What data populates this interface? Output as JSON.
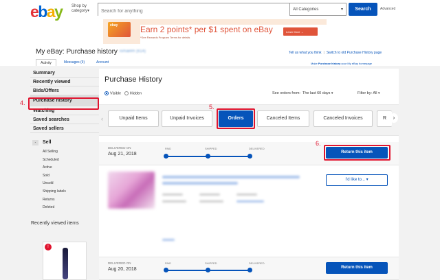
{
  "header": {
    "logo": {
      "e": "e",
      "b": "b",
      "a": "a",
      "y": "y"
    },
    "shop_by": "Shop by category",
    "search_placeholder": "Search for anything",
    "category": "All Categories",
    "search_label": "Search",
    "advanced": "Advanced"
  },
  "banner": {
    "card_label": "ebay",
    "headline": "Earn 2 points* per $1 spent on eBay",
    "fineprint": "*See Rewards Program Terms for details",
    "learn_more": "Learn More"
  },
  "page": {
    "title": "My eBay: Purchase history",
    "username": "ismaelm (614)",
    "links": [
      "Tell us what you think",
      "Switch to old Purchase History page"
    ],
    "homepage_note_pre": "Make ",
    "homepage_note_bold": "Purchase history",
    "homepage_note_post": " your My eBay homepage",
    "tabs": [
      "Activity",
      "Messages (9)",
      "Account"
    ]
  },
  "sidebar": {
    "items": [
      "Summary",
      "Recently viewed",
      "Bids/Offers",
      "Purchase history",
      "Watching",
      "Saved searches",
      "Saved sellers"
    ],
    "sell_label": "Sell",
    "sell_toggle": "-",
    "sell_items": [
      "All Selling",
      "Scheduled",
      "Active",
      "Sold",
      "Unsold",
      "Shipping labels",
      "Returns",
      "Deleted"
    ],
    "recently_viewed": "Recently viewed items",
    "badge": "!"
  },
  "annotations": {
    "step4": "4.",
    "step5": "5.",
    "step6": "6."
  },
  "purchase": {
    "heading": "Purchase History",
    "visible": "Visible",
    "hidden": "Hidden",
    "see_orders_from": "See orders from:",
    "period": "The last 60 days",
    "filter_by": "Filter by:",
    "filter_value": "All",
    "tabs": [
      "Unpaid Items",
      "Unpaid Invoices",
      "Orders",
      "Canceled Items",
      "Canceled Invoices",
      "R"
    ],
    "orders": [
      {
        "delivered_label": "DELIVERED ON",
        "date": "Aug 21, 2018",
        "steps": [
          "PAID",
          "SHIPPED",
          "DELIVERED"
        ],
        "return_label": "Return this item",
        "action_label": "I'd like to..."
      },
      {
        "delivered_label": "DELIVERED ON",
        "date": "Aug 20, 2018",
        "steps": [
          "PAID",
          "SHIPPED",
          "DELIVERED"
        ],
        "return_label": "Return this item"
      }
    ]
  },
  "colors": {
    "brand_blue": "#0654ba",
    "annotation_red": "#e0142f"
  }
}
